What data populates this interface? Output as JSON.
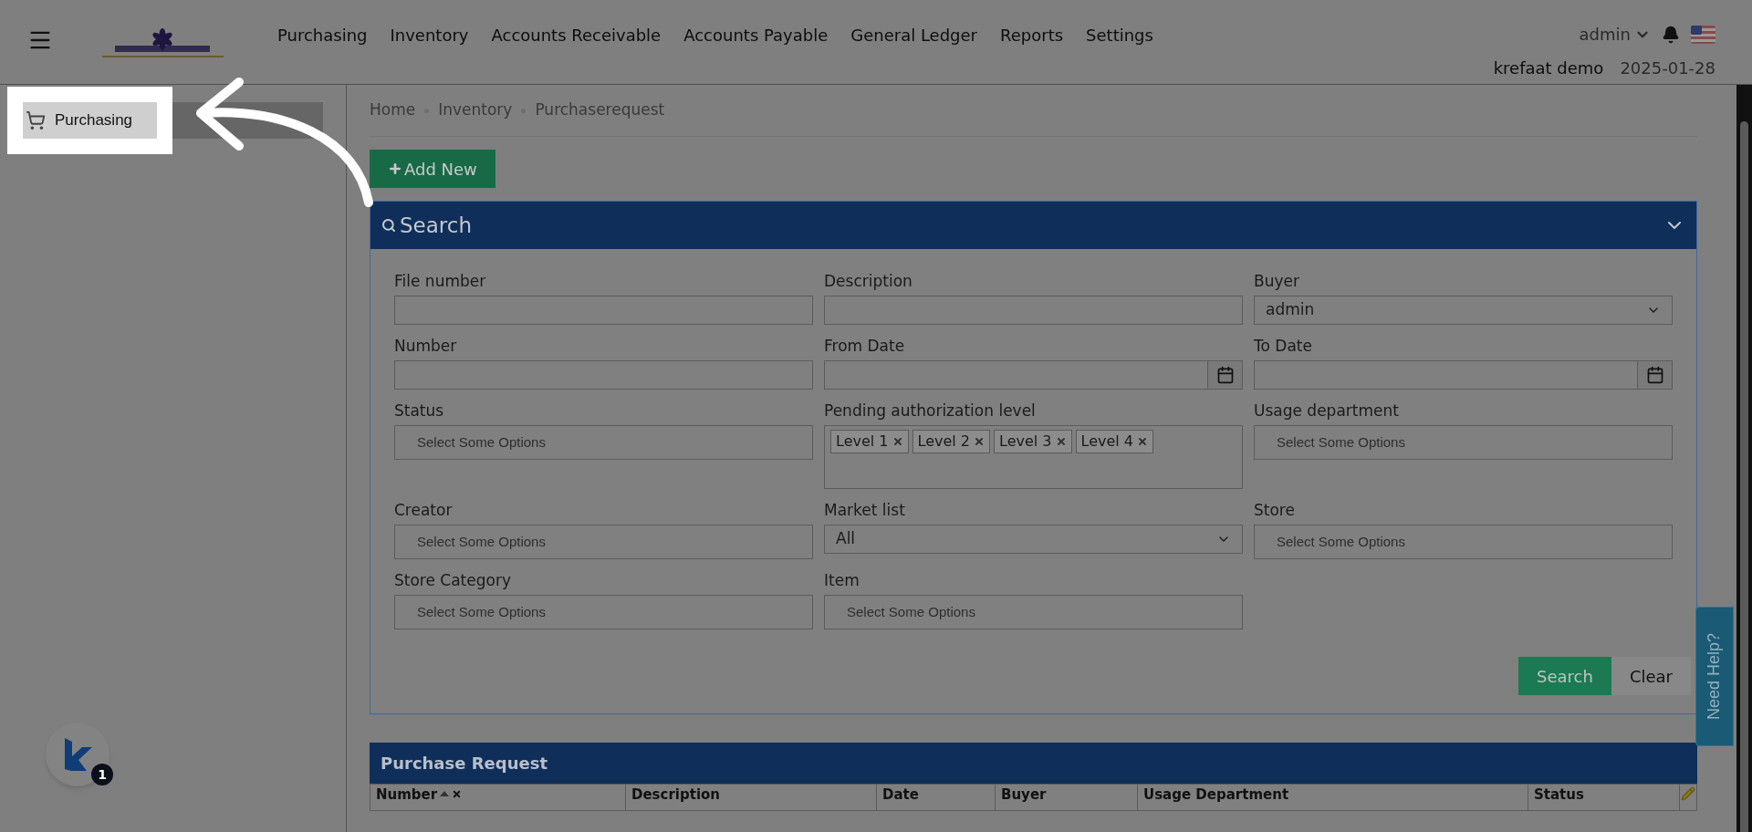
{
  "nav": {
    "items": [
      "Purchasing",
      "Inventory",
      "Accounts Receivable",
      "Accounts Payable",
      "General Ledger",
      "Reports",
      "Settings"
    ]
  },
  "user": {
    "name": "admin",
    "company": "krefaat demo",
    "date": "2025-01-28"
  },
  "sidebar": {
    "items": [
      {
        "label": "Purchasing",
        "selected": true
      }
    ]
  },
  "breadcrumb": [
    "Home",
    "Inventory",
    "Purchaserequest"
  ],
  "add_button": "Add New",
  "search": {
    "title": "Search",
    "expanded": true,
    "fields": [
      {
        "label": "File number",
        "kind": "text"
      },
      {
        "label": "Description",
        "kind": "text"
      },
      {
        "label": "Buyer",
        "kind": "select",
        "value": "admin"
      },
      {
        "label": "Number",
        "kind": "text"
      },
      {
        "label": "From Date",
        "kind": "date"
      },
      {
        "label": "To Date",
        "kind": "date"
      },
      {
        "label": "Status",
        "kind": "multi",
        "placeholder": "Select Some Options"
      },
      {
        "label": "Pending authorization level",
        "kind": "multi",
        "tags": [
          "Level 1",
          "Level 2",
          "Level 3",
          "Level 4"
        ]
      },
      {
        "label": "Usage department",
        "kind": "multi",
        "placeholder": "Select Some Options"
      },
      {
        "label": "Creator",
        "kind": "multi",
        "placeholder": "Select Some Options"
      },
      {
        "label": "Market list",
        "kind": "select",
        "value": "All"
      },
      {
        "label": "Store",
        "kind": "multi",
        "placeholder": "Select Some Options"
      },
      {
        "label": "Store Category",
        "kind": "multi",
        "placeholder": "Select Some Options"
      },
      {
        "label": "Item",
        "kind": "multi",
        "placeholder": "Select Some Options"
      }
    ],
    "buttons": [
      {
        "label": "Search",
        "kind": "primary"
      },
      {
        "label": "Clear",
        "kind": "secondary"
      }
    ]
  },
  "table": {
    "title": "Purchase Request",
    "columns": [
      "Number",
      "Description",
      "Date",
      "Buyer",
      "Usage Department",
      "Status"
    ]
  },
  "help_tab": "Need Help?",
  "widget": {
    "badge": "1"
  }
}
